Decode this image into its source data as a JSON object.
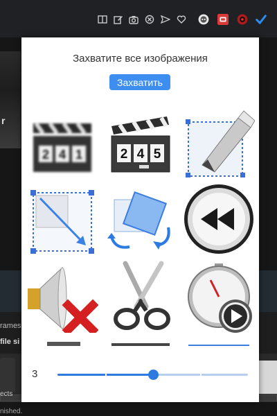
{
  "toolbar": {
    "icons": [
      "reader-mode-icon",
      "edit-icon",
      "camera-icon",
      "block-icon",
      "send-icon",
      "heart-icon",
      "extension-chat-icon",
      "extension-capture-icon",
      "extension-record-icon",
      "extension-check-icon"
    ]
  },
  "background": {
    "letter": "r",
    "frames_text": "rames",
    "file_size_text": "file si",
    "objects_text": "ects",
    "finished_text": "nished."
  },
  "popup": {
    "title": "Захватите все изображения",
    "capture_button": "Захватить",
    "images": [
      {
        "name": "clapperboard-blurred-image",
        "kind": "clapper",
        "digits": [
          "2",
          "4",
          "1"
        ],
        "blur": true
      },
      {
        "name": "clapperboard-image",
        "kind": "clapper",
        "digits": [
          "2",
          "4",
          "5"
        ],
        "blur": false
      },
      {
        "name": "edit-shape-image",
        "kind": "edit"
      },
      {
        "name": "resize-shape-image",
        "kind": "resize"
      },
      {
        "name": "rotate-shape-image",
        "kind": "rotate"
      },
      {
        "name": "rewind-button-image",
        "kind": "rewind"
      },
      {
        "name": "mute-speaker-image",
        "kind": "mute"
      },
      {
        "name": "scissors-image",
        "kind": "scissors"
      },
      {
        "name": "stopwatch-play-image",
        "kind": "stopwatch"
      }
    ],
    "slider": {
      "value": "3",
      "level": 0.5
    }
  },
  "colors": {
    "accent": "#3d8ef0",
    "slider": "#2d7be0"
  }
}
